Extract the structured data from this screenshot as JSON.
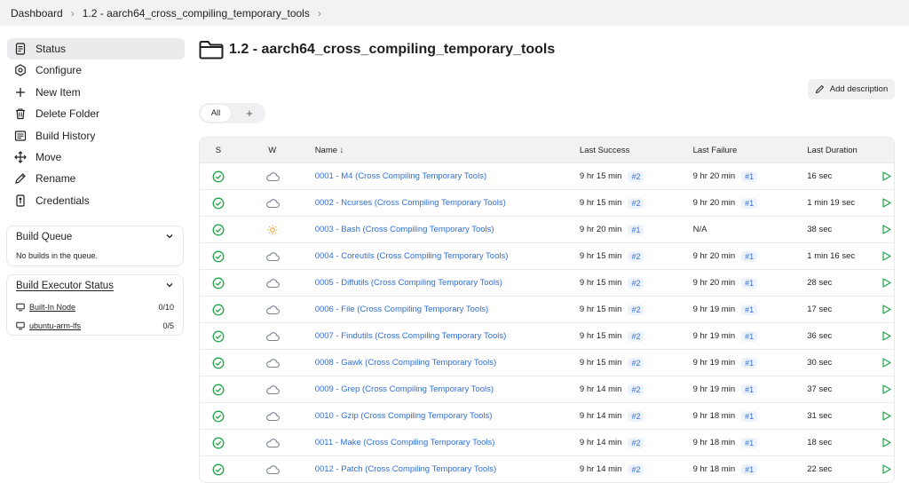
{
  "breadcrumb": [
    "Dashboard",
    "1.2 - aarch64_cross_compiling_temporary_tools"
  ],
  "sidebar": {
    "items": [
      {
        "label": "Status",
        "icon": "status-icon"
      },
      {
        "label": "Configure",
        "icon": "gear-icon"
      },
      {
        "label": "New Item",
        "icon": "plus-icon"
      },
      {
        "label": "Delete Folder",
        "icon": "trash-icon"
      },
      {
        "label": "Build History",
        "icon": "history-icon"
      },
      {
        "label": "Move",
        "icon": "move-icon"
      },
      {
        "label": "Rename",
        "icon": "pencil-icon"
      },
      {
        "label": "Credentials",
        "icon": "credentials-icon"
      }
    ]
  },
  "build_queue": {
    "title": "Build Queue",
    "empty_text": "No builds in the queue."
  },
  "executor_status": {
    "title": "Build Executor Status",
    "nodes": [
      {
        "name": "Built-In Node",
        "count": "0/10"
      },
      {
        "name": "ubuntu-arm-lfs",
        "count": "0/5"
      }
    ]
  },
  "page": {
    "title": "1.2 - aarch64_cross_compiling_temporary_tools",
    "add_description": "Add description"
  },
  "tabs": {
    "all": "All",
    "add": "+"
  },
  "table": {
    "headers": {
      "s": "S",
      "w": "W",
      "name": "Name ↓",
      "last_success": "Last Success",
      "last_failure": "Last Failure",
      "last_duration": "Last Duration"
    },
    "rows": [
      {
        "name": "0001 - M4 (Cross Compiling Temporary Tools)",
        "weather": "cloudy",
        "success": "9 hr 15 min",
        "success_build": "#2",
        "failure": "9 hr 20 min",
        "failure_build": "#1",
        "duration": "16 sec"
      },
      {
        "name": "0002 - Ncurses (Cross Compiling Temporary Tools)",
        "weather": "cloudy",
        "success": "9 hr 15 min",
        "success_build": "#2",
        "failure": "9 hr 20 min",
        "failure_build": "#1",
        "duration": "1 min 19 sec"
      },
      {
        "name": "0003 - Bash (Cross Compiling Temporary Tools)",
        "weather": "sunny",
        "success": "9 hr 20 min",
        "success_build": "#1",
        "failure": "N/A",
        "failure_build": "",
        "duration": "38 sec"
      },
      {
        "name": "0004 - Coreutils (Cross Compiling Temporary Tools)",
        "weather": "cloudy",
        "success": "9 hr 15 min",
        "success_build": "#2",
        "failure": "9 hr 20 min",
        "failure_build": "#1",
        "duration": "1 min 16 sec"
      },
      {
        "name": "0005 - Diffutils (Cross Compiling Temporary Tools)",
        "weather": "cloudy",
        "success": "9 hr 15 min",
        "success_build": "#2",
        "failure": "9 hr 20 min",
        "failure_build": "#1",
        "duration": "28 sec"
      },
      {
        "name": "0006 - File (Cross Compiling Temporary Tools)",
        "weather": "cloudy",
        "success": "9 hr 15 min",
        "success_build": "#2",
        "failure": "9 hr 19 min",
        "failure_build": "#1",
        "duration": "17 sec"
      },
      {
        "name": "0007 - Findutils (Cross Compiling Temporary Tools)",
        "weather": "cloudy",
        "success": "9 hr 15 min",
        "success_build": "#2",
        "failure": "9 hr 19 min",
        "failure_build": "#1",
        "duration": "36 sec"
      },
      {
        "name": "0008 - Gawk (Cross Compiling Temporary Tools)",
        "weather": "cloudy",
        "success": "9 hr 15 min",
        "success_build": "#2",
        "failure": "9 hr 19 min",
        "failure_build": "#1",
        "duration": "30 sec"
      },
      {
        "name": "0009 - Grep (Cross Compiling Temporary Tools)",
        "weather": "cloudy",
        "success": "9 hr 14 min",
        "success_build": "#2",
        "failure": "9 hr 19 min",
        "failure_build": "#1",
        "duration": "37 sec"
      },
      {
        "name": "0010 - Gzip (Cross Compiling Temporary Tools)",
        "weather": "cloudy",
        "success": "9 hr 14 min",
        "success_build": "#2",
        "failure": "9 hr 18 min",
        "failure_build": "#1",
        "duration": "31 sec"
      },
      {
        "name": "0011 - Make (Cross Compiling Temporary Tools)",
        "weather": "cloudy",
        "success": "9 hr 14 min",
        "success_build": "#2",
        "failure": "9 hr 18 min",
        "failure_build": "#1",
        "duration": "18 sec"
      },
      {
        "name": "0012 - Patch (Cross Compiling Temporary Tools)",
        "weather": "cloudy",
        "success": "9 hr 14 min",
        "success_build": "#2",
        "failure": "9 hr 18 min",
        "failure_build": "#1",
        "duration": "22 sec"
      }
    ]
  },
  "colors": {
    "link": "#2f6fd6",
    "success": "#1ea446",
    "sunny": "#e8a13b",
    "cloudy": "#7a8290"
  }
}
